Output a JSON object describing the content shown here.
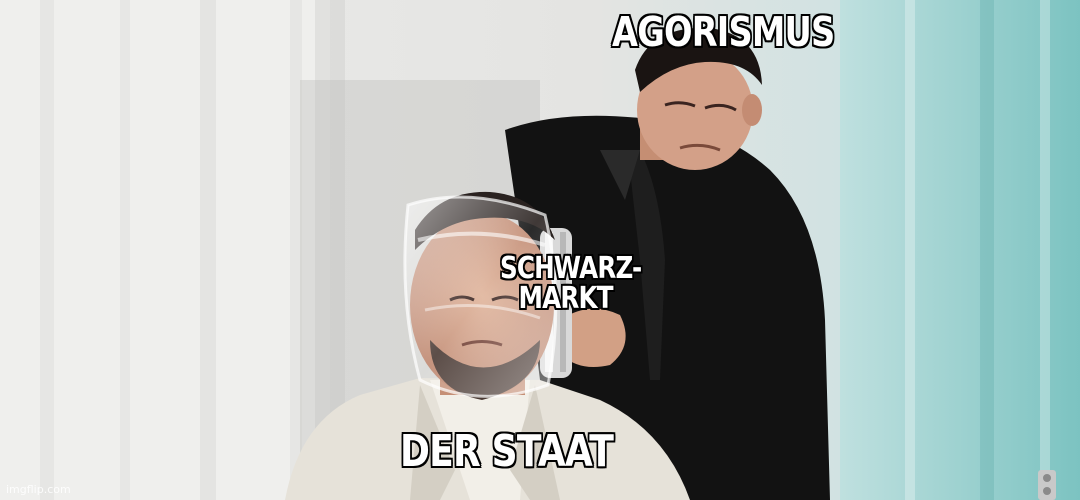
{
  "captions": {
    "top": "AGORISMUS",
    "middle_line1": "SCHWARZ-",
    "middle_line2": "MARKT",
    "bottom": "DER STAAT"
  },
  "watermark": "imgflip.com",
  "colors": {
    "caption_fill": "#ffffff",
    "caption_outline": "#000000",
    "wall": "#e8e8e6",
    "curtain_teal": "#7fc4c2",
    "black_suit": "#121212",
    "white_suit": "#e6e2d9",
    "skin": "#d6a58a"
  }
}
